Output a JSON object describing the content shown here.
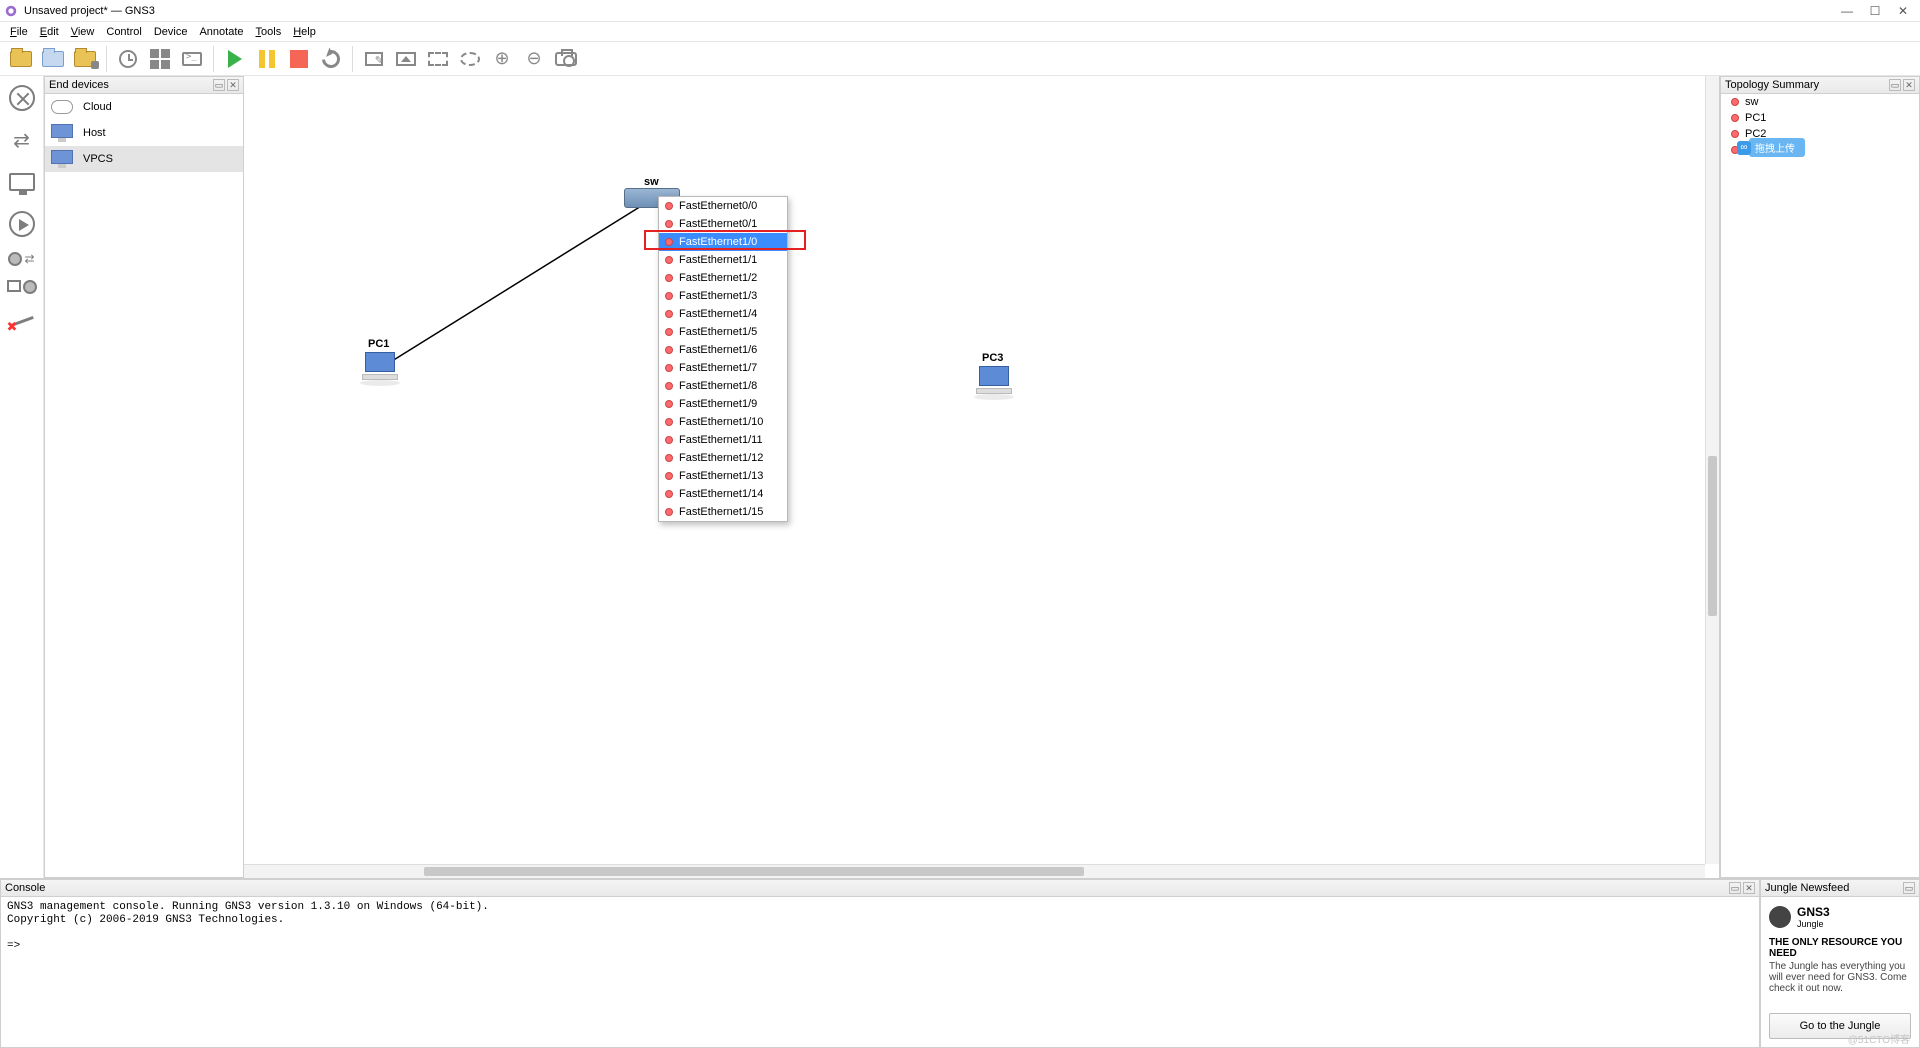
{
  "window": {
    "title": "Unsaved project* — GNS3"
  },
  "menu": {
    "items": [
      "File",
      "Edit",
      "View",
      "Control",
      "Device",
      "Annotate",
      "Tools",
      "Help"
    ]
  },
  "panels": {
    "end_devices": {
      "title": "End devices",
      "items": [
        "Cloud",
        "Host",
        "VPCS"
      ],
      "selected": 2
    },
    "topology": {
      "title": "Topology Summary",
      "items": [
        "sw",
        "PC1",
        "PC2",
        "PC3"
      ]
    },
    "console": {
      "title": "Console",
      "lines": "GNS3 management console. Running GNS3 version 1.3.10 on Windows (64-bit).\nCopyright (c) 2006-2019 GNS3 Technologies.\n\n=>"
    },
    "jungle": {
      "title": "Jungle Newsfeed",
      "brand": "GNS3",
      "brand_sub": "Jungle",
      "headline": "THE ONLY RESOURCE YOU NEED",
      "blurb": "The Jungle has everything you will ever need for GNS3. Come check it out now.",
      "button": "Go to the Jungle"
    }
  },
  "canvas": {
    "nodes": {
      "sw": "sw",
      "pc1": "PC1",
      "pc3": "PC3"
    }
  },
  "context_menu": {
    "highlighted_index": 2,
    "items": [
      "FastEthernet0/0",
      "FastEthernet0/1",
      "FastEthernet1/0",
      "FastEthernet1/1",
      "FastEthernet1/2",
      "FastEthernet1/3",
      "FastEthernet1/4",
      "FastEthernet1/5",
      "FastEthernet1/6",
      "FastEthernet1/7",
      "FastEthernet1/8",
      "FastEthernet1/9",
      "FastEthernet1/10",
      "FastEthernet1/11",
      "FastEthernet1/12",
      "FastEthernet1/13",
      "FastEthernet1/14",
      "FastEthernet1/15"
    ]
  },
  "misc": {
    "upload_badge": "拖拽上传",
    "watermark": "@51CTO博客"
  }
}
